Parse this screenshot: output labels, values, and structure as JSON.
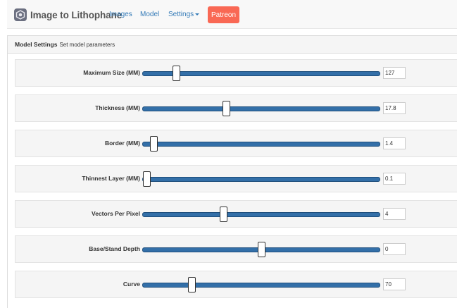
{
  "navbar": {
    "brand": "Image to Lithophane",
    "items": [
      {
        "label": "Images"
      },
      {
        "label": "Model"
      },
      {
        "label": "Settings"
      }
    ],
    "patreon_label": "Patreon",
    "patreon_color": "#f96854"
  },
  "panel": {
    "title": "Model Settings",
    "subtitle": "Set model parameters"
  },
  "sliders": [
    {
      "label": "Maximum Size (MM)",
      "value": "127",
      "position": 0.14
    },
    {
      "label": "Thickness (MM)",
      "value": "17.8",
      "position": 0.35
    },
    {
      "label": "Border (MM)",
      "value": "1.4",
      "position": 0.045
    },
    {
      "label": "Thinnest Layer (MM)",
      "value": "0.1",
      "position": 0.015
    },
    {
      "label": "Vectors Per Pixel",
      "value": "4",
      "position": 0.34
    },
    {
      "label": "Base/Stand Depth",
      "value": "0",
      "position": 0.5
    },
    {
      "label": "Curve",
      "value": "70",
      "position": 0.205
    }
  ],
  "colors": {
    "accent": "#337ab7",
    "slider_fill": "#336fa8"
  }
}
